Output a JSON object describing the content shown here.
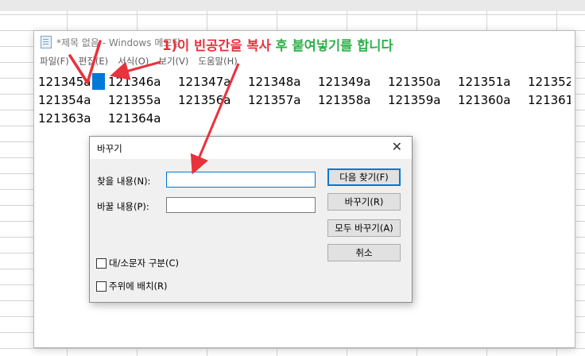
{
  "notepad": {
    "title": "*제목 없음 - Windows 메모장",
    "menu": [
      "파일(F)",
      "편집(E)",
      "서식(O)",
      "보기(V)",
      "도움말(H)"
    ],
    "lines": [
      [
        "121345a",
        "121346a",
        "121347a",
        "121348a",
        "121349a",
        "121350a",
        "121351a",
        "121352"
      ],
      [
        "121354a",
        "121355a",
        "121356a",
        "121357a",
        "121358a",
        "121359a",
        "121360a",
        "121361"
      ],
      [
        "121363a",
        "121364a"
      ]
    ]
  },
  "dialog": {
    "title": "바꾸기",
    "close_glyph": "✕",
    "find_label": "찾을 내용(N):",
    "replace_label": "바꿀 내용(P):",
    "buttons": {
      "find_next": "다음 찾기(F)",
      "replace": "바꾸기(R)",
      "replace_all": "모두 바꾸기(A)",
      "cancel": "취소"
    },
    "checkboxes": {
      "match_case": "대/소문자 구분(C)",
      "wrap_around": "주위에 배치(R)"
    }
  },
  "annotation": {
    "part1": "1)이 빈공간을 복사",
    "part2": "후 붙여넣기를 합니다",
    "color_red": "#e8323c",
    "color_green": "#2eb14a"
  }
}
